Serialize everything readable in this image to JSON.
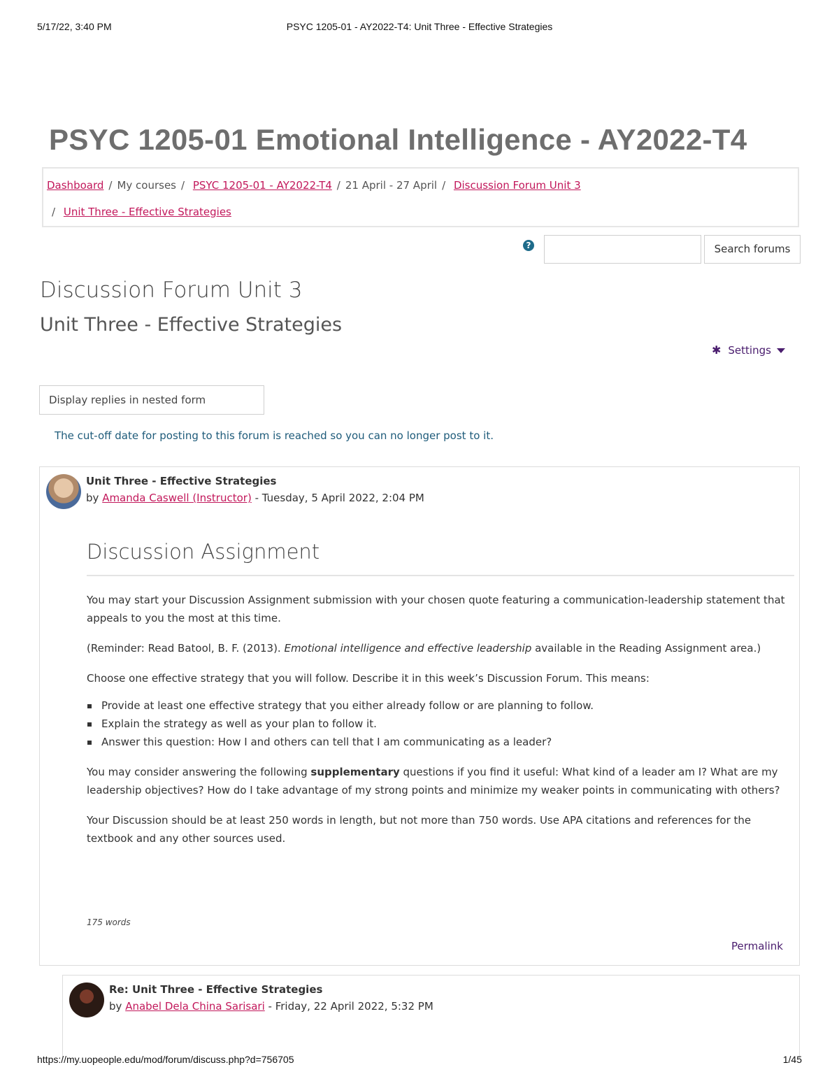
{
  "print_header": {
    "datetime": "5/17/22, 3:40 PM",
    "page_title": "PSYC 1205-01 - AY2022-T4: Unit Three - Effective Strategies"
  },
  "course_title": "PSYC 1205-01 Emotional Intelligence - AY2022-T4",
  "breadcrumb": {
    "dashboard": "Dashboard",
    "my_courses": "My courses",
    "course": "PSYC 1205-01 - AY2022-T4",
    "week": "21 April - 27 April",
    "forum": "Discussion Forum Unit 3",
    "discussion": "Unit Three - Effective Strategies",
    "separator": "/"
  },
  "search": {
    "help_icon": "question-circle-icon",
    "value": "",
    "button_label": "Search forums"
  },
  "forum_heading": "Discussion Forum Unit 3",
  "discussion_heading": "Unit Three - Effective Strategies",
  "settings": {
    "label": "Settings",
    "icon": "gear-icon"
  },
  "display_mode": {
    "selected": "Display replies in nested form"
  },
  "cutoff_notice": "The cut-off date for posting to this forum is reached so you can no longer post to it.",
  "posts": [
    {
      "subject": "Unit Three - Effective Strategies",
      "by": "by",
      "author": "Amanda Caswell (Instructor)",
      "date": "- Tuesday, 5 April 2022, 2:04 PM",
      "heading": "Discussion Assignment",
      "p1": "You may start your Discussion Assignment submission with your chosen quote featuring a communication-leadership statement that appeals to you the most at this time.",
      "p2_start": "(Reminder: Read Batool, B. F. (2013). ",
      "p2_italic": "Emotional intelligence and effective leadership",
      "p2_end": " available in the Reading Assignment area.)",
      "p3": "Choose one effective strategy that you will follow. Describe it in this week’s Discussion Forum. This means:",
      "bullets": [
        "Provide at least one effective strategy that you either already follow or are planning to follow.",
        "Explain the strategy as well as your plan to follow it.",
        "Answer this question: How I and others can tell that I am communicating as a leader?"
      ],
      "p4_start": "You may consider answering the following ",
      "p4_bold": "supplementary",
      "p4_end": " questions if you find it useful: What kind of a leader am I? What are my leadership objectives? How do I take advantage of my strong points and minimize my weaker points in communicating with others?",
      "p5": "Your Discussion should be at least 250 words in length, but not more than 750 words. Use APA citations and references for the textbook and any other sources used.",
      "word_count": "175 words",
      "permalink": "Permalink"
    },
    {
      "subject": "Re: Unit Three - Effective Strategies",
      "by": "by",
      "author": "Anabel Dela China Sarisari",
      "date": "- Friday, 22 April 2022, 5:32 PM"
    }
  ],
  "print_footer": {
    "url": "https://my.uopeople.edu/mod/forum/discuss.php?d=756705",
    "page": "1/45"
  }
}
